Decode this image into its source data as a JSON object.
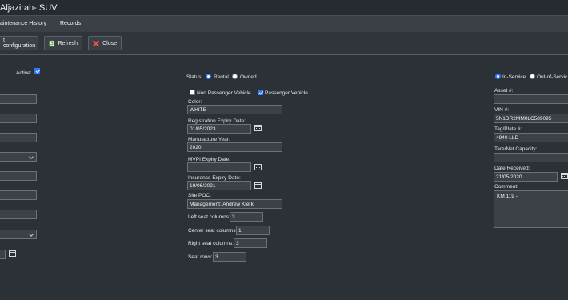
{
  "window": {
    "title": "Aljazirah- SUV"
  },
  "tabs": [
    {
      "label": "aintenance History"
    },
    {
      "label": "Records"
    }
  ],
  "toolbar": {
    "config_label": "t configuration",
    "refresh_label": "Refresh",
    "close_label": "Close"
  },
  "left": {
    "active_label": "Active:",
    "active_checked": true
  },
  "center": {
    "status_label": "Status:",
    "status_options": [
      "Rental",
      "Owned"
    ],
    "status_selected": "Rental",
    "non_passenger_label": "Non Passenger Vehicle",
    "passenger_label": "Passenger Vehicle",
    "color_label": "Color:",
    "color_value": "WHITE",
    "reg_expiry_label": "Registration Expiry Date:",
    "reg_expiry_value": "01/05/2023",
    "manufacture_year_label": "Manufacture Year:",
    "manufacture_year_value": "2020",
    "mvpi_label": "MVPI Expiry Date:",
    "mvpi_value": "",
    "insurance_label": "Insurance Expiry Date:",
    "insurance_value": "19/06/2021",
    "site_poc_label": "Site POC:",
    "site_poc_value": "Management: Andrew Klerk",
    "left_seat_label": "Left seat columns:",
    "left_seat_value": "3",
    "center_seat_label": "Center seat columns:",
    "center_seat_value": "1",
    "right_seat_label": "Right seat columns:",
    "right_seat_value": "3",
    "seat_rows_label": "Seat rows:",
    "seat_rows_value": "3"
  },
  "right": {
    "service_options": [
      "In-Service",
      "Out-of-Servic"
    ],
    "service_selected": "In-Service",
    "asset_label": "Asset #:",
    "asset_value": "",
    "vin_label": "VIN #:",
    "vin_value": "5N1DR2MM0LC589095",
    "tag_label": "Tag/Plate #:",
    "tag_value": "4940 LLD",
    "tare_label": "Tare/Net Capacity:",
    "tare_value": "",
    "date_received_label": "Date Received:",
    "date_received_value": "21/05/2020",
    "comment_label": "Comment:",
    "comment_value": "KM 119 -"
  },
  "colors": {
    "background": "#2b3136",
    "accent": "#2d7cf6",
    "close_icon": "#e8553b",
    "refresh_icon": "#9bd36a"
  }
}
